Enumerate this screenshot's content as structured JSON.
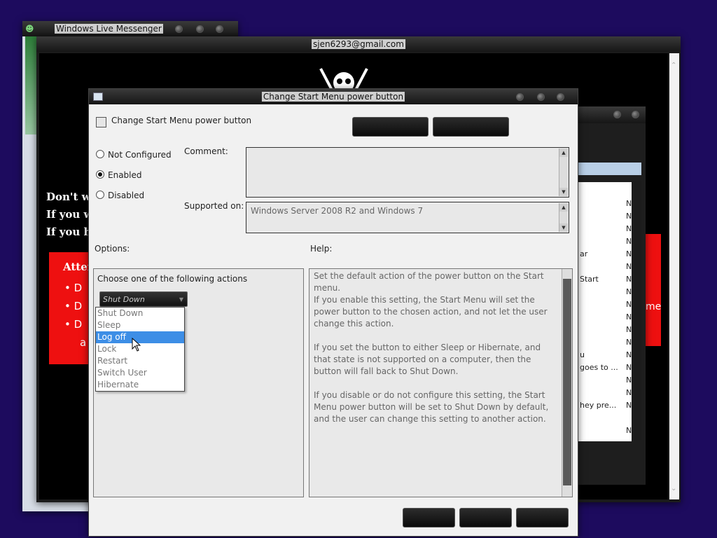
{
  "wlm": {
    "title": "Windows Live Messenger"
  },
  "mail": {
    "title": "sjen6293@gmail.com",
    "lines": [
      "Don't w",
      "If you w",
      "If you h"
    ],
    "attention": "Atten",
    "bullets": [
      "D",
      "D",
      "D"
    ],
    "bullet_extra": "a",
    "right_fragment": "me"
  },
  "gp": {
    "n_mark": "N",
    "fragments": [
      "ar",
      "Start",
      "u",
      "goes to ...",
      "hey pre..."
    ]
  },
  "dialog": {
    "title": "Change Start Menu power button",
    "header": "Change Start Menu power button",
    "radio": [
      "Not Configured",
      "Enabled",
      "Disabled"
    ],
    "selected_radio": "Enabled",
    "comment_label": "Comment:",
    "supported_label": "Supported on:",
    "supported_value": "Windows Server 2008 R2 and Windows 7",
    "options_label": "Options:",
    "help_label": "Help:",
    "choose_label": "Choose one of the following actions",
    "combo_value": "Shut Down",
    "dropdown_options": [
      "Shut Down",
      "Sleep",
      "Log off",
      "Lock",
      "Restart",
      "Switch User",
      "Hibernate"
    ],
    "highlighted_option": "Log off",
    "help_paragraphs": [
      "Set the default action of the power button on the Start menu.",
      "If you enable this setting, the Start Menu will set the power button to the chosen action, and not let the user change this action.",
      "If you set the button to either Sleep or Hibernate, and that state is not supported on a computer, then the button will fall back to Shut Down.",
      "If you disable or do not configure this setting, the Start Menu power button will be set to Shut Down by default, and the user can change this setting to another action."
    ]
  },
  "colors": {
    "desktop": "#1d0b5e",
    "highlight": "#3d8ee6",
    "red_box": "#ee1010"
  }
}
